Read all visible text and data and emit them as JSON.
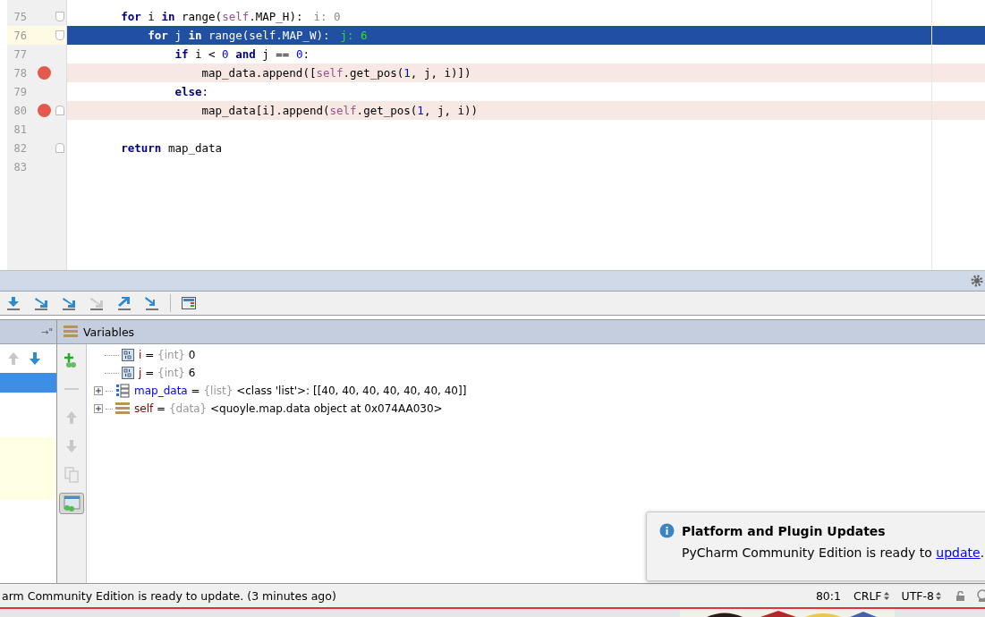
{
  "editor": {
    "lines": [
      {
        "number": "75",
        "breakpoint": false,
        "current": false,
        "fold_start": true,
        "fold_end": false,
        "tokens": [
          {
            "kind": "keyword",
            "text": "        for"
          },
          {
            "kind": "plain",
            "text": " i "
          },
          {
            "kind": "keyword",
            "text": "in"
          },
          {
            "kind": "plain",
            "text": " range("
          },
          {
            "kind": "self",
            "text": "self"
          },
          {
            "kind": "plain",
            "text": ".MAP_H):"
          }
        ],
        "inline_value": "i: 0"
      },
      {
        "number": "76",
        "breakpoint": false,
        "current": true,
        "fold_start": true,
        "fold_end": false,
        "tokens": [
          {
            "kind": "keyword",
            "text": "            for"
          },
          {
            "kind": "plain",
            "text": " j "
          },
          {
            "kind": "keyword",
            "text": "in"
          },
          {
            "kind": "plain",
            "text": " range("
          },
          {
            "kind": "self",
            "text": "self"
          },
          {
            "kind": "plain",
            "text": ".MAP_W):"
          }
        ],
        "inline_value": "j: 6"
      },
      {
        "number": "77",
        "breakpoint": false,
        "current": false,
        "fold_start": false,
        "fold_end": false,
        "tokens": [
          {
            "kind": "keyword",
            "text": "                if"
          },
          {
            "kind": "plain",
            "text": " i < "
          },
          {
            "kind": "number",
            "text": "0"
          },
          {
            "kind": "keyword",
            "text": " and"
          },
          {
            "kind": "plain",
            "text": " j == "
          },
          {
            "kind": "number",
            "text": "0"
          },
          {
            "kind": "plain",
            "text": ":"
          }
        ]
      },
      {
        "number": "78",
        "breakpoint": true,
        "current": false,
        "fold_start": false,
        "fold_end": false,
        "tokens": [
          {
            "kind": "plain",
            "text": "                    map_data.append(["
          },
          {
            "kind": "self",
            "text": "self"
          },
          {
            "kind": "plain",
            "text": ".get_pos("
          },
          {
            "kind": "number",
            "text": "1"
          },
          {
            "kind": "plain",
            "text": ", j, i)])"
          }
        ]
      },
      {
        "number": "79",
        "breakpoint": false,
        "current": false,
        "fold_start": false,
        "fold_end": false,
        "tokens": [
          {
            "kind": "keyword",
            "text": "                else"
          },
          {
            "kind": "plain",
            "text": ":"
          }
        ]
      },
      {
        "number": "80",
        "breakpoint": true,
        "current": false,
        "fold_start": false,
        "fold_end": true,
        "tokens": [
          {
            "kind": "plain",
            "text": "                    map_data[i].append("
          },
          {
            "kind": "self",
            "text": "self"
          },
          {
            "kind": "plain",
            "text": ".get_pos("
          },
          {
            "kind": "number",
            "text": "1"
          },
          {
            "kind": "plain",
            "text": ", j, i))"
          }
        ]
      },
      {
        "number": "81",
        "breakpoint": false,
        "current": false,
        "fold_start": false,
        "fold_end": false
      },
      {
        "number": "82",
        "breakpoint": false,
        "current": false,
        "fold_start": false,
        "fold_end": true,
        "tokens": [
          {
            "kind": "keyword",
            "text": "        return"
          },
          {
            "kind": "plain",
            "text": " map_data"
          }
        ]
      },
      {
        "number": "83",
        "breakpoint": false,
        "current": false,
        "fold_start": false,
        "fold_end": false
      }
    ]
  },
  "debug_toolbar": {
    "buttons": [
      {
        "kind": "step-over",
        "disabled": false
      },
      {
        "kind": "step-into",
        "disabled": false
      },
      {
        "kind": "step-into-my",
        "disabled": false
      },
      {
        "kind": "force-step",
        "disabled": true
      },
      {
        "kind": "step-out",
        "disabled": false
      },
      {
        "kind": "run-to-cursor",
        "disabled": false
      },
      {
        "kind": "evaluate",
        "disabled": false
      }
    ]
  },
  "frames": {
    "pin": "→\"",
    "up_disabled": true,
    "down_disabled": false
  },
  "variables": {
    "title": "Variables",
    "items": [
      {
        "kind": "int",
        "name": "i",
        "operator": "=",
        "type": "{int}",
        "value": "0",
        "expandable": false
      },
      {
        "kind": "int",
        "name": "j",
        "operator": "=",
        "type": "{int}",
        "value": "6",
        "expandable": false
      },
      {
        "kind": "list",
        "name": "map_data",
        "operator": "=",
        "type": "{list}",
        "value": "<class 'list'>: [[40, 40, 40, 40, 40, 40, 40]]",
        "expandable": true
      },
      {
        "kind": "object",
        "name": "self",
        "operator": "=",
        "type": "{data}",
        "value": "<quoyle.map.data object at 0x074AA030>",
        "expandable": true
      }
    ]
  },
  "notification": {
    "title": "Platform and Plugin Updates",
    "message": "PyCharm Community Edition is ready to ",
    "link": "update",
    "after": "."
  },
  "status_bar": {
    "message": "arm Community Edition is ready to update. (3 minutes ago)",
    "position": "80:1",
    "line_ending": "CRLF",
    "encoding": "UTF-8"
  }
}
